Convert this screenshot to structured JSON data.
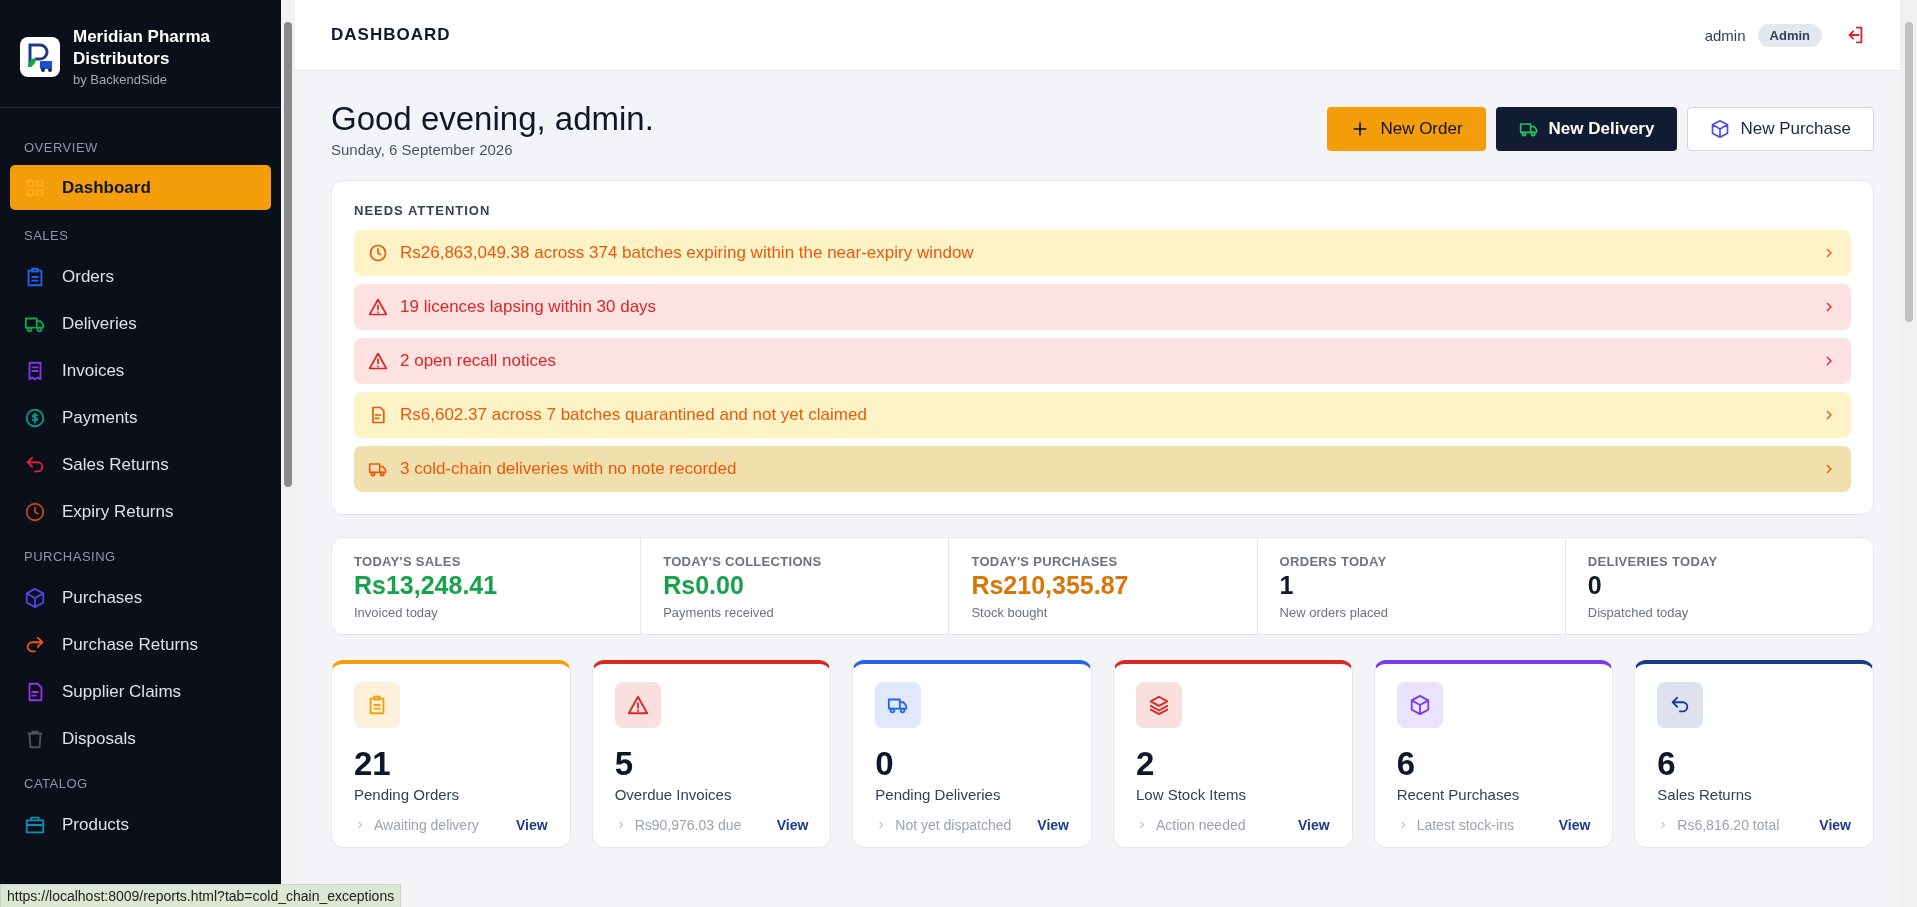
{
  "brand": {
    "name": "Meridian Pharma Distributors",
    "byline": "by BackendSide"
  },
  "sidebar": {
    "sections": [
      {
        "title": "OVERVIEW",
        "items": [
          {
            "label": "Dashboard",
            "kind": "grid",
            "color": "#f59e0b",
            "selected": true
          }
        ]
      },
      {
        "title": "SALES",
        "items": [
          {
            "label": "Orders",
            "kind": "clipboard",
            "color": "#2563eb",
            "selected": false
          },
          {
            "label": "Deliveries",
            "kind": "truck",
            "color": "#16a34a",
            "selected": false
          },
          {
            "label": "Invoices",
            "kind": "receipt",
            "color": "#7c3aed",
            "selected": false
          },
          {
            "label": "Payments",
            "kind": "coin",
            "color": "#0d9488",
            "selected": false
          },
          {
            "label": "Sales Returns",
            "kind": "undo",
            "color": "#e11d48",
            "selected": false
          },
          {
            "label": "Expiry Returns",
            "kind": "clock",
            "color": "#c2410c",
            "selected": false
          }
        ]
      },
      {
        "title": "PURCHASING",
        "items": [
          {
            "label": "Purchases",
            "kind": "cube",
            "color": "#4f46e5",
            "selected": false
          },
          {
            "label": "Purchase Returns",
            "kind": "redo",
            "color": "#ea580c",
            "selected": false
          },
          {
            "label": "Supplier Claims",
            "kind": "doc",
            "color": "#9333ea",
            "selected": false
          },
          {
            "label": "Disposals",
            "kind": "trash",
            "color": "#52525b",
            "selected": false
          }
        ]
      },
      {
        "title": "CATALOG",
        "items": [
          {
            "label": "Products",
            "kind": "briefcase",
            "color": "#0891b2",
            "selected": false
          }
        ]
      }
    ]
  },
  "header": {
    "title": "DASHBOARD",
    "user": "admin",
    "role": "Admin"
  },
  "greeting": {
    "title": "Good evening, admin.",
    "date": "Sunday, 6 September 2026"
  },
  "actions": [
    {
      "label": "New Order",
      "kind": "order"
    },
    {
      "label": "New Delivery",
      "kind": "delivery"
    },
    {
      "label": "New Purchase",
      "kind": "purchase"
    }
  ],
  "attention": {
    "title": "NEEDS ATTENTION",
    "items": [
      {
        "text": "Rs26,863,049.38 across 374 batches expiring within the near-expiry window",
        "kind": "expiry",
        "hovered": false
      },
      {
        "text": "19 licences lapsing within 30 days",
        "kind": "licence",
        "hovered": false
      },
      {
        "text": "2 open recall notices",
        "kind": "recall",
        "hovered": false
      },
      {
        "text": "Rs6,602.37 across 7 batches quarantined and not yet claimed",
        "kind": "quarantine",
        "hovered": false
      },
      {
        "text": "3 cold-chain deliveries with no note recorded",
        "kind": "coldchain",
        "hovered": true
      }
    ]
  },
  "stats": [
    {
      "label": "TODAY'S SALES",
      "value": "Rs13,248.41",
      "note": "Invoiced today",
      "color": "#16a34a"
    },
    {
      "label": "TODAY'S COLLECTIONS",
      "value": "Rs0.00",
      "note": "Payments received",
      "color": "#16a34a"
    },
    {
      "label": "TODAY'S PURCHASES",
      "value": "Rs210,355.87",
      "note": "Stock bought",
      "color": "#d97706"
    },
    {
      "label": "ORDERS TODAY",
      "value": "1",
      "note": "New orders placed",
      "color": "#0f172a"
    },
    {
      "label": "DELIVERIES TODAY",
      "value": "0",
      "note": "Dispatched today",
      "color": "#0f172a"
    }
  ],
  "tiles": [
    {
      "count": "21",
      "label": "Pending Orders",
      "note": "Awaiting delivery",
      "link": "View",
      "kind": "clipboard",
      "color": "#f59e0b"
    },
    {
      "count": "5",
      "label": "Overdue Invoices",
      "note": "Rs90,976.03 due",
      "link": "View",
      "kind": "warning",
      "color": "#dc2626"
    },
    {
      "count": "0",
      "label": "Pending Deliveries",
      "note": "Not yet dispatched",
      "link": "View",
      "kind": "truck",
      "color": "#2563eb"
    },
    {
      "count": "2",
      "label": "Low Stock Items",
      "note": "Action needed",
      "link": "View",
      "kind": "layers",
      "color": "#dc2626"
    },
    {
      "count": "6",
      "label": "Recent Purchases",
      "note": "Latest stock-ins",
      "link": "View",
      "kind": "cube",
      "color": "#7c3aed"
    },
    {
      "count": "6",
      "label": "Sales Returns",
      "note": "Rs6,816.20 total",
      "link": "View",
      "kind": "undo",
      "color": "#1e3a8a"
    }
  ],
  "status_url": "https://localhost:8009/reports.html?tab=cold_chain_exceptions"
}
